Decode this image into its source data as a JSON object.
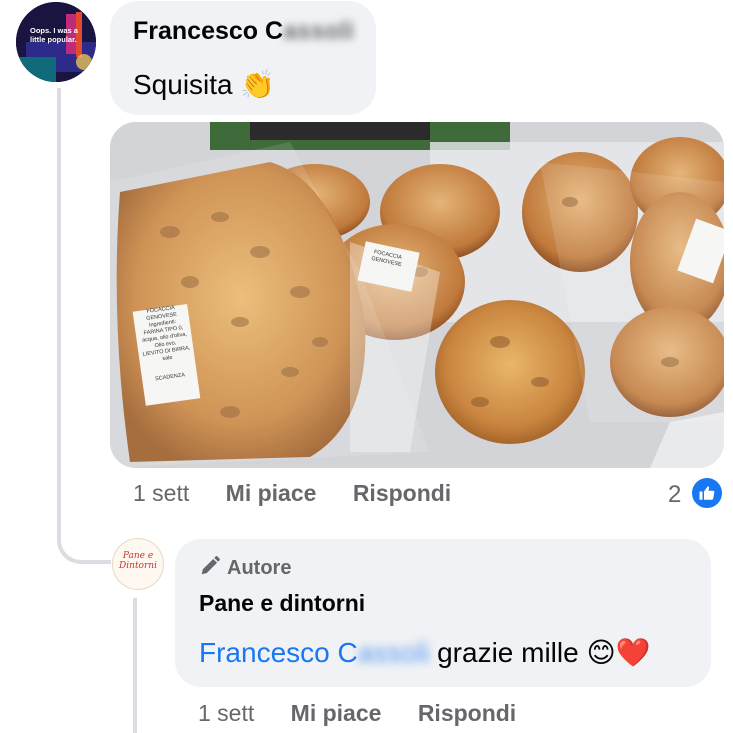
{
  "comment": {
    "author": "Francesco C",
    "author_blurred": "assoli",
    "text": "Squisita",
    "emoji": "👏",
    "avatar_text": "Oops. I was a little popular.",
    "time": "1 sett",
    "like_label": "Mi piace",
    "reply_label": "Rispondi",
    "like_count": "2"
  },
  "reply": {
    "badge_label": "Autore",
    "author": "Pane e dintorni",
    "mention": "Francesco C",
    "mention_blurred": "assoli",
    "text": "grazie mille",
    "emojis": "😊❤️",
    "avatar_text": "Pane e Dintorni",
    "time": "1 sett",
    "like_label": "Mi piace",
    "reply_label": "Rispondi"
  },
  "photo": {
    "label_lines": [
      "FOCACCIA GENOVESE",
      "Ingredienti:",
      "FARINA TIPO 0,",
      "acqua, olio d'oliva, Olio evo,",
      "LIEVITO DI BIRRA, sale",
      "SCADENZA"
    ],
    "small_label": "FOCACCIA GENOVESE"
  },
  "colors": {
    "accent": "#1877f2",
    "bubble": "#f0f2f5",
    "muted": "#65676b",
    "line": "#dadde1"
  }
}
